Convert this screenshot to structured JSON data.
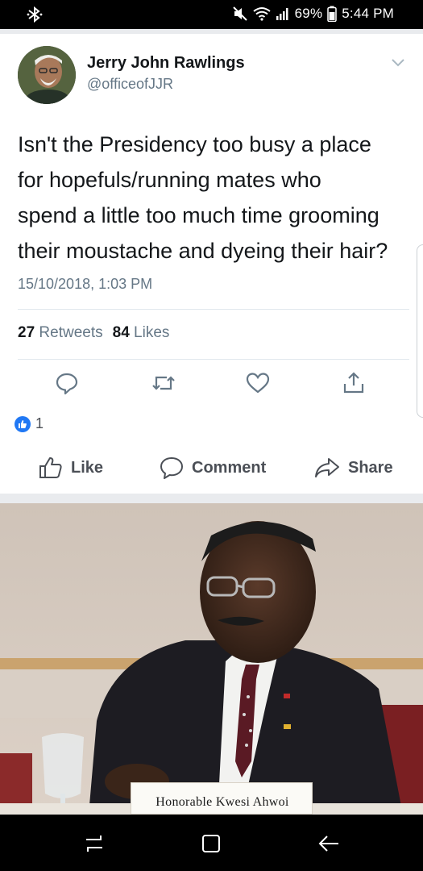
{
  "status_bar": {
    "battery": "69%",
    "time": "5:44 PM",
    "icons": [
      "bluetooth-icon",
      "mute-icon",
      "wifi-icon",
      "signal-icon",
      "battery-icon"
    ]
  },
  "tweet": {
    "author_name": "Jerry John Rawlings",
    "author_handle": "@officeofJJR",
    "text_lines": [
      "Isn't the Presidency too busy a place",
      "for hopefuls/running mates who",
      "spend a little too much time grooming",
      "their moustache and dyeing their hair?"
    ],
    "timestamp": "15/10/2018, 1:03 PM",
    "retweet_count": "27",
    "retweets_label": "Retweets",
    "like_count": "84",
    "likes_label": "Likes",
    "actions": [
      "reply-icon",
      "retweet-icon",
      "like-heart-icon",
      "share-icon"
    ]
  },
  "facebook": {
    "reaction_count": "1",
    "like_label": "Like",
    "comment_label": "Comment",
    "share_label": "Share"
  },
  "photo": {
    "nameplate_text": "Honorable Kwesi Ahwoi"
  },
  "colors": {
    "twitter_gray": "#657786",
    "fb_blue": "#2078f4",
    "text_dark": "#14171a"
  }
}
